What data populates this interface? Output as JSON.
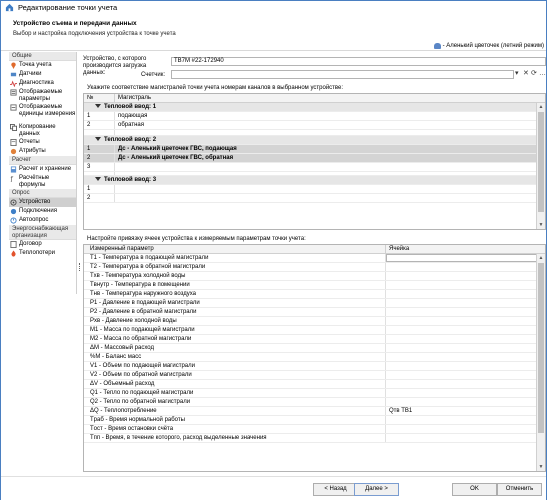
{
  "window": {
    "title": "Редактирование точки учета"
  },
  "header": {
    "title": "Устройство съема и передачи данных",
    "subtitle": "Выбор и настройка подключения устройства к точке учета",
    "user": "- Аленький цветочек (летний режим)"
  },
  "sidebar": {
    "groups": [
      {
        "label": "Общие",
        "items": [
          {
            "label": "Точка учета",
            "icon": "location-icon"
          },
          {
            "label": "Датчики",
            "icon": "sensor-icon"
          },
          {
            "label": "Диагностика",
            "icon": "diagnostics-icon"
          },
          {
            "label": "Отображаемые параметры",
            "icon": "parameters-icon"
          },
          {
            "label": "Отображаемые единицы измерения",
            "icon": "units-icon"
          },
          {
            "label": "Копирование данных",
            "icon": "copy-icon"
          },
          {
            "label": "Отчеты",
            "icon": "reports-icon"
          },
          {
            "label": "Атрибуты",
            "icon": "attributes-icon"
          }
        ]
      },
      {
        "label": "Расчет",
        "items": [
          {
            "label": "Расчет и хранение",
            "icon": "calculation-icon"
          },
          {
            "label": "Расчётные формулы",
            "icon": "formula-icon"
          }
        ]
      },
      {
        "label": "Опрос",
        "items": [
          {
            "label": "Устройство",
            "icon": "device-icon",
            "selected": true
          },
          {
            "label": "Подключения",
            "icon": "connections-icon"
          },
          {
            "label": "Автоопрос",
            "icon": "autopoll-icon"
          }
        ]
      },
      {
        "label": "Энергоснабжающая организация",
        "items": [
          {
            "label": "Договор",
            "icon": "contract-icon"
          },
          {
            "label": "Теплопотери",
            "icon": "heatloss-icon"
          }
        ]
      }
    ]
  },
  "device": {
    "label": "Устройство, с которого производится загрузка данных:",
    "value": "ТВ7М #22-172940",
    "counter_label": "Счетчик:",
    "counter_value": ""
  },
  "channels": {
    "title": "Укажите соответствие магистралей точки учета номерам каналов в выбранном устройстве:",
    "columns": [
      "№",
      "Магистраль"
    ],
    "groups": [
      {
        "name": "Тепловой ввод: 1",
        "rows": [
          {
            "num": "1",
            "name": "подающая",
            "selected": false
          },
          {
            "num": "2",
            "name": "обратная",
            "selected": false
          }
        ]
      },
      {
        "name": "Тепловой ввод: 2",
        "rows": [
          {
            "num": "1",
            "name": "Дс - Аленький цветочек ГВС, подающая",
            "selected": true
          },
          {
            "num": "2",
            "name": "Дс - Аленький цветочек ГВС, обратная",
            "selected": true
          },
          {
            "num": "3",
            "name": "",
            "selected": false
          }
        ]
      },
      {
        "name": "Тепловой ввод: 3",
        "rows": [
          {
            "num": "1",
            "name": "",
            "selected": false
          },
          {
            "num": "2",
            "name": "",
            "selected": false
          }
        ]
      }
    ]
  },
  "binding": {
    "title": "Настройте привязку ячеек устройства к измеряемым параметрам точки учета:",
    "columns": [
      "Измеренный параметр",
      "Ячейка"
    ],
    "rows": [
      {
        "param": "T1 - Температура в подающей магистрали",
        "cell": ""
      },
      {
        "param": "T2 - Температура в обратной магистрали",
        "cell": ""
      },
      {
        "param": "Tхв - Температура холодной воды",
        "cell": ""
      },
      {
        "param": "Tвнутр - Температура в помещении",
        "cell": ""
      },
      {
        "param": "Tнв - Температура наружного воздуха",
        "cell": ""
      },
      {
        "param": "P1 - Давление в подающей магистрали",
        "cell": ""
      },
      {
        "param": "P2 - Давление в обратной магистрали",
        "cell": ""
      },
      {
        "param": "Pхв - Давление холодной воды",
        "cell": ""
      },
      {
        "param": "M1 - Масса по подающей магистрали",
        "cell": ""
      },
      {
        "param": "M2 - Масса по обратной магистрали",
        "cell": ""
      },
      {
        "param": "ΔM - Массовый расход",
        "cell": ""
      },
      {
        "param": "%M - Баланс масс",
        "cell": ""
      },
      {
        "param": "V1 - Объем по подающей магистрали",
        "cell": ""
      },
      {
        "param": "V2 - Объем по обратной магистрали",
        "cell": ""
      },
      {
        "param": "ΔV - Объемный расход",
        "cell": ""
      },
      {
        "param": "Q1 - Тепло по подающей магистрали",
        "cell": ""
      },
      {
        "param": "Q2 - Тепло по обратной магистрали",
        "cell": ""
      },
      {
        "param": "ΔQ - Теплопотребление",
        "cell": "Qтв ТВ1"
      },
      {
        "param": "Tраб - Время нормальной работы",
        "cell": ""
      },
      {
        "param": "Tост - Время остановки счёта",
        "cell": ""
      },
      {
        "param": "Tпп - Время, в течение которого, расход выделенные значения",
        "cell": ""
      }
    ]
  },
  "footer": {
    "back": "< Назад",
    "next": "Далее >",
    "ok": "OK",
    "cancel": "Отменить"
  }
}
